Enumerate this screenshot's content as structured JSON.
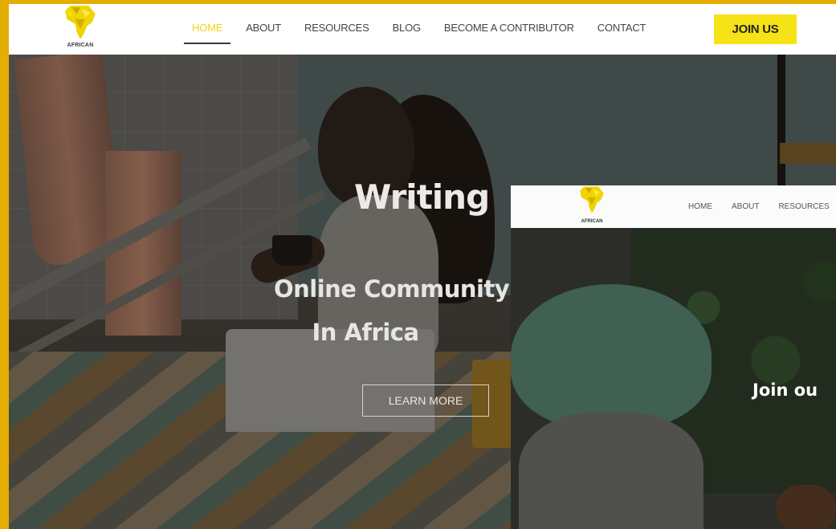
{
  "main": {
    "logo_text": "AFRICAN",
    "nav": [
      "HOME",
      "ABOUT",
      "RESOURCES",
      "BLOG",
      "BECOME A CONTRIBUTOR",
      "CONTACT"
    ],
    "join_label": "JOIN US",
    "hero_title": "Writing",
    "hero_sub_line1": "Online Community Of F",
    "hero_sub_line2": "In Africa",
    "cta_label": "LEARN MORE"
  },
  "front": {
    "logo_text": "AFRICAN",
    "nav": [
      "HOME",
      "ABOUT",
      "RESOURCES"
    ],
    "hero_title": "Join ou"
  },
  "colors": {
    "frame": "#e4ad02",
    "active_nav": "#f4d21c",
    "join_button": "#f6e317"
  }
}
